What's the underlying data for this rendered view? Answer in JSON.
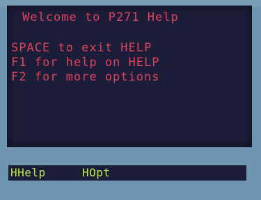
{
  "screen": {
    "title": "Welcome to P271 Help",
    "lines": [
      "SPACE to exit HELP",
      "F1 for help on HELP",
      "F2 for more options"
    ]
  },
  "function_keys": [
    {
      "label": "HHelp"
    },
    {
      "label": "HOpt"
    }
  ],
  "colors": {
    "screen_background": "#1c1d38",
    "text": "#e0425e",
    "function_key_text": "#b9e84a",
    "bezel": "#6f95b1"
  }
}
